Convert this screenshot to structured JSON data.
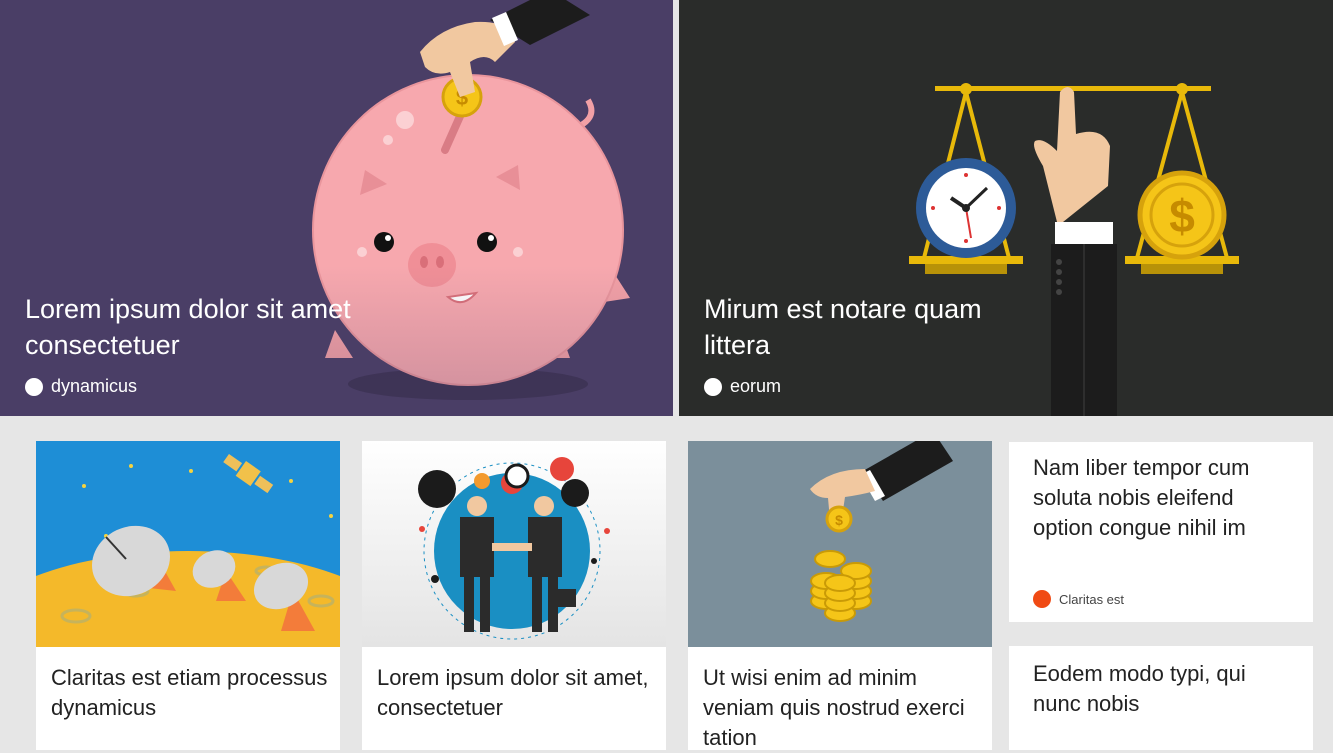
{
  "hero_left": {
    "title": "Lorem ipsum dolor sit amet consectetuer",
    "author": "dynamicus",
    "background": "#4a3e66",
    "icon": "piggy-bank-icon"
  },
  "hero_right": {
    "title": "Mirum est notare quam littera",
    "author": "eorum",
    "background": "#2a2c2a",
    "icon": "scale-icon"
  },
  "cards": [
    {
      "title": "Claritas est etiam processus dynamicus",
      "icon": "satellite-dish-icon"
    },
    {
      "title": "Lorem ipsum dolor sit amet, consectetuer",
      "icon": "handshake-icon"
    },
    {
      "title": "Ut wisi enim ad minim veniam quis nostrud exerci tation",
      "icon": "coins-icon"
    }
  ],
  "text_cards": [
    {
      "title": "Nam liber tempor cum soluta nobis eleifend option congue nihil im",
      "author": "Claritas est",
      "accent": "#f04a14"
    },
    {
      "title": "Eodem modo typi, qui nunc nobis"
    }
  ]
}
